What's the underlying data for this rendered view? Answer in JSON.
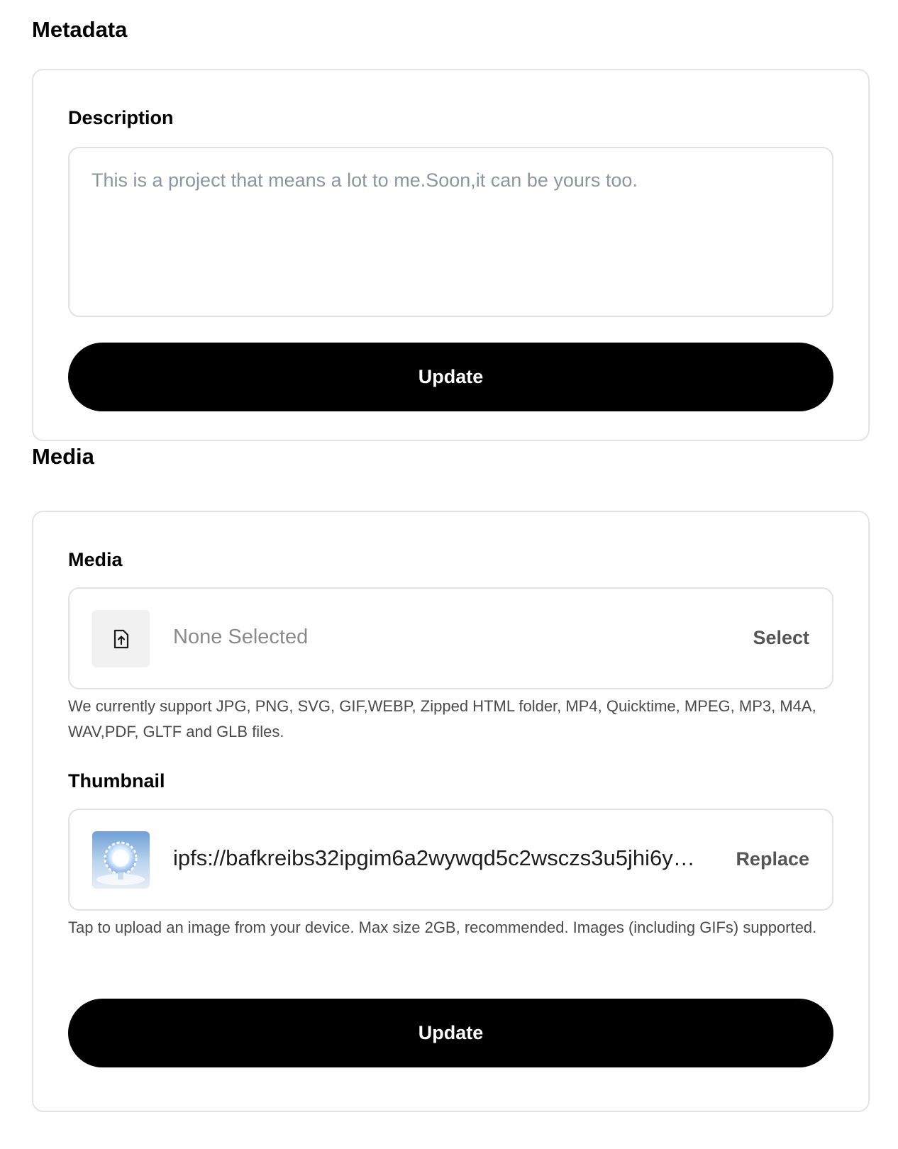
{
  "metadata": {
    "section_title": "Metadata",
    "description_label": "Description",
    "description_placeholder": "This is a project that means a lot to me.Soon,it can be yours too.",
    "update_label": "Update"
  },
  "media": {
    "section_title": "Media",
    "media_label": "Media",
    "media_file": {
      "value": "None Selected",
      "action": "Select",
      "icon": "file-upload-icon"
    },
    "media_hint": "We currently support JPG, PNG, SVG, GIF,WEBP, Zipped HTML folder, MP4, Quicktime, MPEG, MP3, M4A, WAV,PDF, GLTF and GLB files.",
    "thumbnail_label": "Thumbnail",
    "thumbnail_file": {
      "value": "ipfs://bafkreibs32ipgim6a2wywqd5c2wsczs3u5jhi6y…",
      "action": "Replace",
      "icon": "thumbnail-image"
    },
    "thumbnail_hint": "Tap to upload an image from your device. Max size 2GB, recommended. Images (including GIFs) supported.",
    "update_label": "Update"
  },
  "colors": {
    "button_bg": "#000000",
    "button_text": "#ffffff",
    "border": "#e2e2e2",
    "placeholder": "#8c96a3",
    "action_text": "#555555"
  }
}
